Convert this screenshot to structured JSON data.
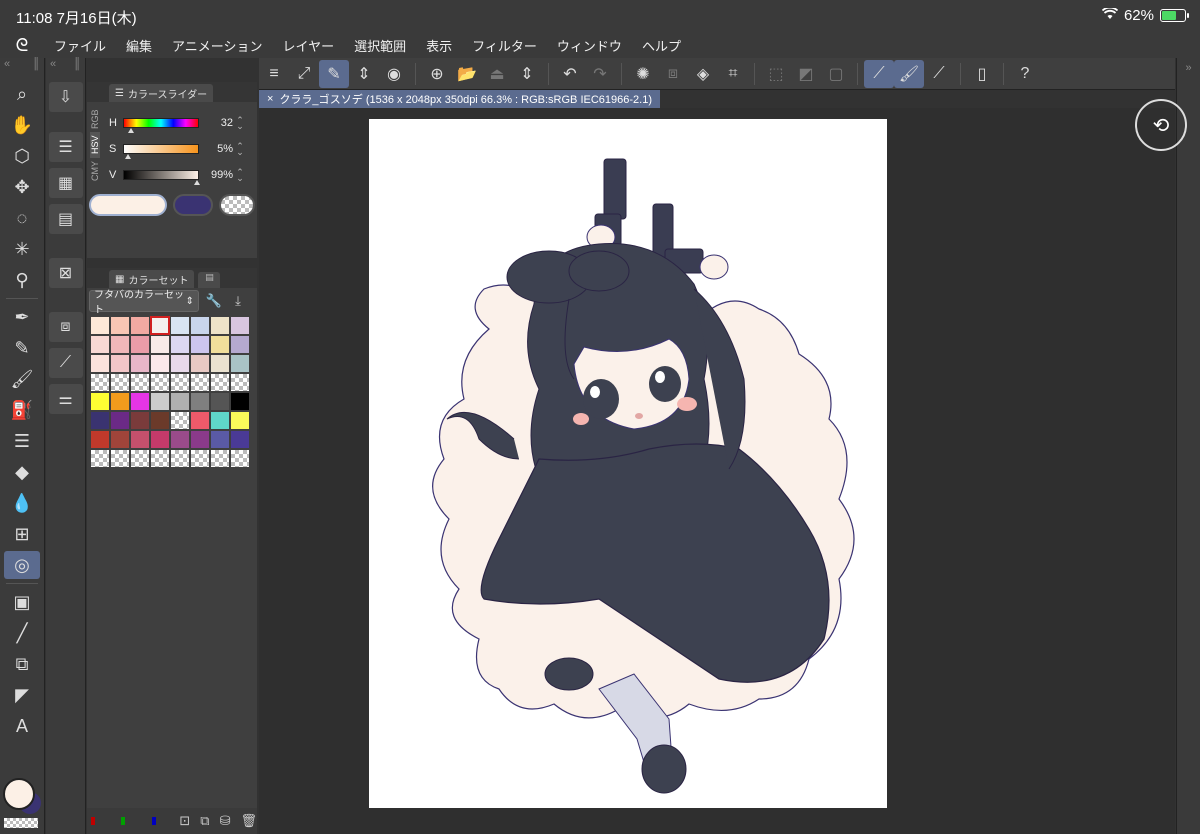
{
  "status": {
    "time_date": "11:08   7月16日(木)",
    "wifi_icon": "wifi-icon",
    "battery_pct": "62%",
    "battery_level": 0.62
  },
  "menu": [
    "ファイル",
    "編集",
    "アニメーション",
    "レイヤー",
    "選択範囲",
    "表示",
    "フィルター",
    "ウィンドウ",
    "ヘルプ"
  ],
  "color_slider": {
    "tab_label": "カラースライダー",
    "modes": [
      "RGB",
      "HSV",
      "CMY"
    ],
    "active_mode": "HSV",
    "h": {
      "label": "H",
      "value": "32",
      "level": 0.09
    },
    "s": {
      "label": "S",
      "value": "5%",
      "level": 0.05
    },
    "v": {
      "label": "V",
      "value": "99%",
      "level": 0.99
    },
    "main_color": "#fcf0e6",
    "sub_color": "#3a3372"
  },
  "color_set": {
    "tab_label": "カラーセット",
    "set_name": "フタバのカラーセット",
    "rows": [
      [
        "#fde8d8",
        "#f9c6b4",
        "#f2a9a2",
        "#f4f0ee",
        "#d9e4f3",
        "#c9d5ec",
        "#eee3c8",
        "#d9c6e0"
      ],
      [
        "#f8d8d4",
        "#f0b7b9",
        "#ea9ca8",
        "#f8eae8",
        "#dcd7f2",
        "#cdc5ee",
        "#f1df9b",
        "#b5a9d0"
      ],
      [
        "#fbe2dc",
        "#f3c6c8",
        "#e8b6c8",
        "#fbe8ea",
        "#e8d9ea",
        "#e8c9c4",
        "#eae2d0",
        "#a9c3c6"
      ],
      [
        "checker",
        "checker",
        "checker",
        "checker",
        "checker",
        "checker",
        "checker",
        "checker"
      ],
      [
        "#ffff33",
        "#f29b1c",
        "#e635e6",
        "#cccccc",
        "#b0b0b0",
        "#7f7f7f",
        "#555555",
        "#000000"
      ],
      [
        "#3a3370",
        "#6b2a86",
        "#7a3b3b",
        "#6b3a2a",
        "checker",
        "#ee5a6a",
        "#5fd6c9",
        "#fafa5a"
      ],
      [
        "#c0392b",
        "#a0443a",
        "#c4506c",
        "#c43a6a",
        "#9a4b8a",
        "#8a3a8a",
        "#5a5aa6",
        "#4a3a96"
      ],
      [
        "checker",
        "checker",
        "checker",
        "checker",
        "checker",
        "checker",
        "checker",
        "checker"
      ]
    ],
    "selected": [
      0,
      3
    ]
  },
  "document": {
    "tab_title": "クララ_ゴスソデ (1536 x 2048px 350dpi 66.3% : RGB:sRGB IEC61966-2.1)"
  }
}
